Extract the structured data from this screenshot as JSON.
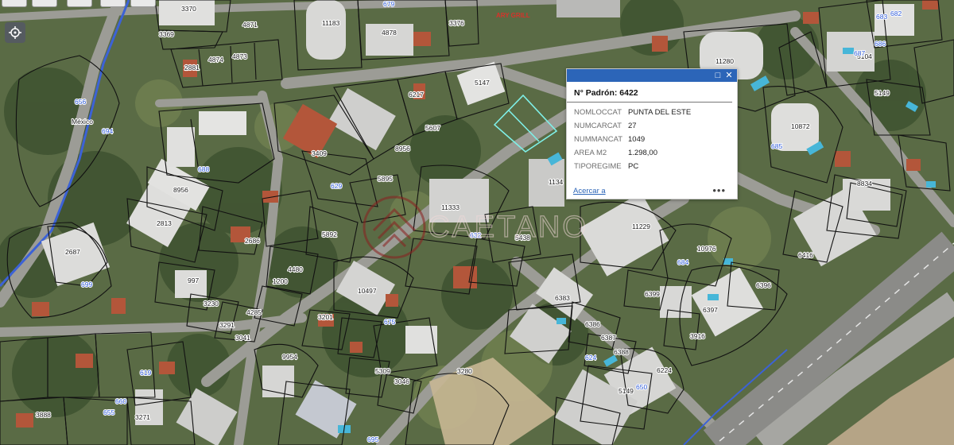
{
  "map": {
    "parcel_labels": [
      "3370",
      "3369",
      "4871",
      "4878",
      "11183",
      "3376",
      "2881",
      "4874",
      "4873",
      "5147",
      "11280",
      "5104",
      "5149",
      "6217",
      "5607",
      "8956",
      "3409",
      "5895",
      "11333",
      "10872",
      "8834",
      "8956",
      "2813",
      "2686",
      "5892",
      "5438",
      "11229",
      "10976",
      "6416",
      "2687",
      "997",
      "4480",
      "1200",
      "3230",
      "4285",
      "3291",
      "3041",
      "10497",
      "3201",
      "6383",
      "6399",
      "6396",
      "6397",
      "6386",
      "6387",
      "6388",
      "6224",
      "5149",
      "3916",
      "3271",
      "3888",
      "9954",
      "5309",
      "3046",
      "1134",
      "3280"
    ],
    "street_labels": [
      "679",
      "683",
      "686",
      "685",
      "695",
      "643",
      "656",
      "694",
      "688",
      "629",
      "632",
      "684",
      "699",
      "675",
      "624",
      "655",
      "619",
      "682",
      "687",
      "660",
      "650"
    ],
    "place_labels": [
      "México"
    ],
    "business_label": "ARY GRILL"
  },
  "watermark": {
    "text": "CAETANO"
  },
  "popup": {
    "title": "N° Padrón: 6422",
    "rows": [
      {
        "key": "NOMLOCCAT",
        "value": "PUNTA DEL ESTE"
      },
      {
        "key": "NUMCARCAT",
        "value": "27"
      },
      {
        "key": "NUMMANCAT",
        "value": "1049"
      },
      {
        "key": "AREA M2",
        "value": "1.298,00"
      },
      {
        "key": "TIPOREGIME",
        "value": "PC"
      }
    ],
    "zoom_link": "Acercar a",
    "more": "•••"
  }
}
